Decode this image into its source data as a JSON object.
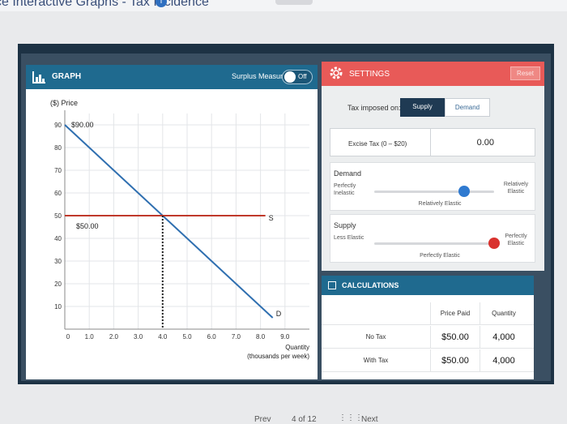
{
  "page": {
    "title": "ce Interactive Graphs - Tax Incidence",
    "info_glyph": "i"
  },
  "graph_panel": {
    "title": "GRAPH",
    "surplus_label": "Surplus Measures",
    "surplus_toggle": "Off"
  },
  "chart_data": {
    "type": "line",
    "ylabel": "($) Price",
    "xlabel_line1": "Quantity",
    "xlabel_line2": "(thousands per week)",
    "y_ticks": [
      90,
      80,
      70,
      60,
      50,
      40,
      30,
      20,
      10
    ],
    "x_ticks": [
      "0",
      "1.0",
      "2.0",
      "3.0",
      "4.0",
      "5.0",
      "6.0",
      "7.0",
      "8.0",
      "9.0"
    ],
    "xlim": [
      0,
      10
    ],
    "ylim": [
      0,
      95
    ],
    "grid": true,
    "series": [
      {
        "name": "D",
        "color": "#2f6fb0",
        "x": [
          0,
          8.5
        ],
        "y": [
          90,
          5
        ]
      },
      {
        "name": "S",
        "color": "#c0392b",
        "x": [
          0,
          8.2
        ],
        "y": [
          50,
          50
        ]
      }
    ],
    "annotations": {
      "price_top": "$90.00",
      "price_equilibrium": "$50.00",
      "equilibrium_quantity": 4.0
    }
  },
  "settings": {
    "title": "SETTINGS",
    "reset_label": "Reset",
    "tax_imposed_label": "Tax imposed on:",
    "tax_options": [
      "Supply",
      "Demand"
    ],
    "tax_selected": "Supply",
    "excise_label": "Excise Tax (0 – $20)",
    "excise_value": "0.00",
    "demand": {
      "heading": "Demand",
      "left_label": "Perfectly Inelastic",
      "right_label": "Relatively Elastic",
      "value_label": "Relatively Elastic",
      "position": 0.75,
      "color": "#2f7ad0"
    },
    "supply": {
      "heading": "Supply",
      "left_label": "Less Elastic",
      "right_label": "Perfectly Elastic",
      "value_label": "Perfectly Elastic",
      "position": 1.0,
      "color": "#d9322e"
    }
  },
  "calculations": {
    "title": "CALCULATIONS",
    "columns": [
      "",
      "Price Paid",
      "Quantity"
    ],
    "rows": [
      {
        "label": "No Tax",
        "price": "$50.00",
        "quantity": "4,000"
      },
      {
        "label": "With Tax",
        "price": "$50.00",
        "quantity": "4,000"
      }
    ]
  },
  "nav": {
    "prev": "Prev",
    "page": "4 of 12",
    "next": "Next"
  }
}
